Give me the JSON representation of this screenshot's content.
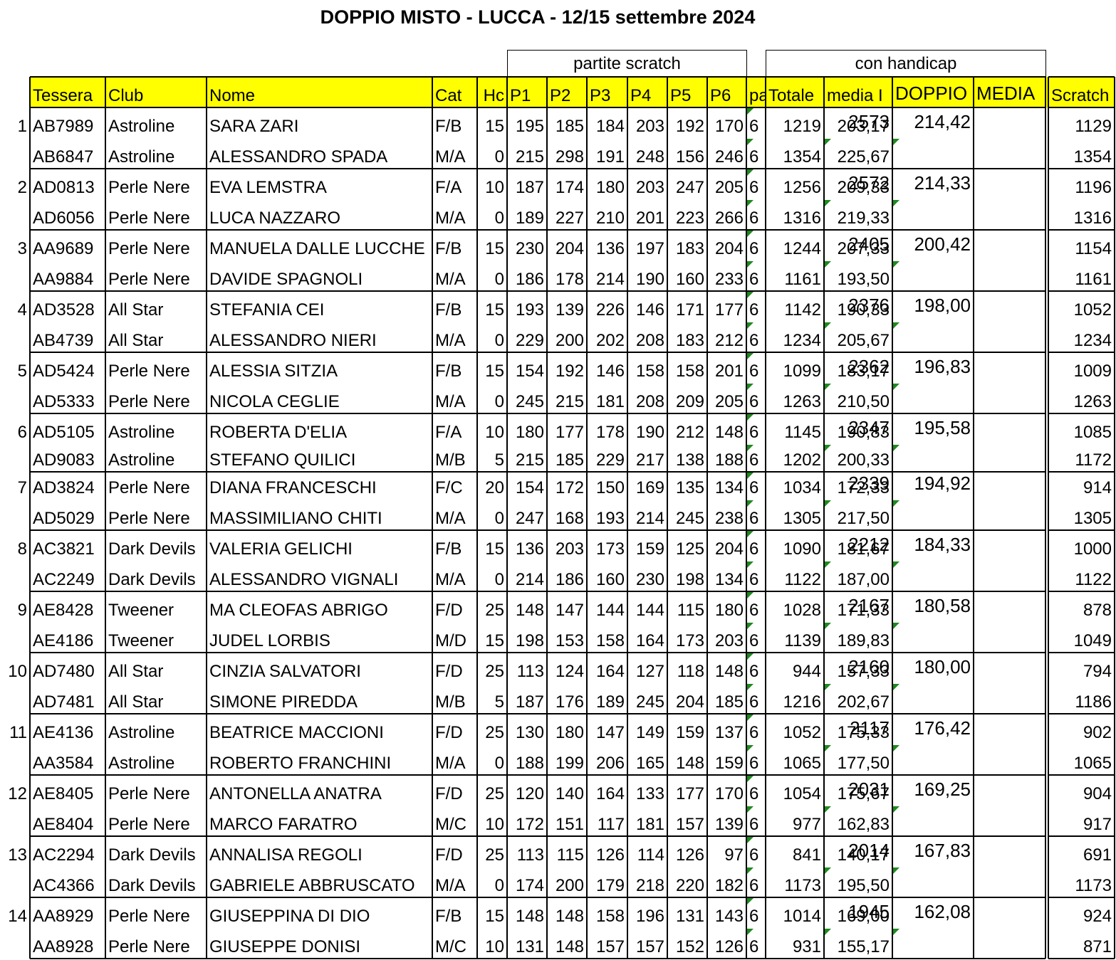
{
  "title": "DOPPIO MISTO - LUCCA - 12/15 settembre 2024",
  "groups": {
    "scratch": "partite scratch",
    "handicap": "con handicap"
  },
  "headers": [
    "Tessera",
    "Club",
    "Nome",
    "Cat",
    "Hc",
    "P1",
    "P2",
    "P3",
    "P4",
    "P5",
    "P6",
    "pa",
    "Totale",
    "media I",
    "DOPPIO",
    "MEDIA",
    "Scratch"
  ],
  "colors": {
    "header_fill": "#ffff00",
    "grid": "#000000",
    "flag": "#1e8a1e"
  },
  "teams": [
    {
      "pos": "1",
      "doppio": "2573",
      "media": "214,42",
      "players": [
        {
          "tessera": "AB7989",
          "club": "Astroline",
          "nome": "SARA ZARI",
          "cat": "F/B",
          "hc": "15",
          "p": [
            "195",
            "185",
            "184",
            "203",
            "192",
            "170"
          ],
          "pa": "6",
          "totale": "1219",
          "media_i": "203,17",
          "scratch": "1129"
        },
        {
          "tessera": "AB6847",
          "club": "Astroline",
          "nome": "ALESSANDRO SPADA",
          "cat": "M/A",
          "hc": "0",
          "p": [
            "215",
            "298",
            "191",
            "248",
            "156",
            "246"
          ],
          "pa": "6",
          "totale": "1354",
          "media_i": "225,67",
          "scratch": "1354"
        }
      ]
    },
    {
      "pos": "2",
      "doppio": "2572",
      "media": "214,33",
      "players": [
        {
          "tessera": "AD0813",
          "club": "Perle Nere",
          "nome": "EVA LEMSTRA",
          "cat": "F/A",
          "hc": "10",
          "p": [
            "187",
            "174",
            "180",
            "203",
            "247",
            "205"
          ],
          "pa": "6",
          "totale": "1256",
          "media_i": "209,33",
          "scratch": "1196"
        },
        {
          "tessera": "AD6056",
          "club": "Perle Nere",
          "nome": "LUCA NAZZARO",
          "cat": "M/A",
          "hc": "0",
          "p": [
            "189",
            "227",
            "210",
            "201",
            "223",
            "266"
          ],
          "pa": "6",
          "totale": "1316",
          "media_i": "219,33",
          "scratch": "1316"
        }
      ]
    },
    {
      "pos": "3",
      "doppio": "2405",
      "media": "200,42",
      "players": [
        {
          "tessera": "AA9689",
          "club": "Perle Nere",
          "nome": "MANUELA DALLE LUCCHE",
          "cat": "F/B",
          "hc": "15",
          "p": [
            "230",
            "204",
            "136",
            "197",
            "183",
            "204"
          ],
          "pa": "6",
          "totale": "1244",
          "media_i": "207,33",
          "scratch": "1154"
        },
        {
          "tessera": "AA9884",
          "club": "Perle Nere",
          "nome": "DAVIDE SPAGNOLI",
          "cat": "M/A",
          "hc": "0",
          "p": [
            "186",
            "178",
            "214",
            "190",
            "160",
            "233"
          ],
          "pa": "6",
          "totale": "1161",
          "media_i": "193,50",
          "scratch": "1161"
        }
      ]
    },
    {
      "pos": "4",
      "doppio": "2376",
      "media": "198,00",
      "players": [
        {
          "tessera": "AD3528",
          "club": "All Star",
          "nome": "STEFANIA CEI",
          "cat": "F/B",
          "hc": "15",
          "p": [
            "193",
            "139",
            "226",
            "146",
            "171",
            "177"
          ],
          "pa": "6",
          "totale": "1142",
          "media_i": "190,33",
          "scratch": "1052"
        },
        {
          "tessera": "AB4739",
          "club": "All Star",
          "nome": "ALESSANDRO NIERI",
          "cat": "M/A",
          "hc": "0",
          "p": [
            "229",
            "200",
            "202",
            "208",
            "183",
            "212"
          ],
          "pa": "6",
          "totale": "1234",
          "media_i": "205,67",
          "scratch": "1234"
        }
      ]
    },
    {
      "pos": "5",
      "doppio": "2362",
      "media": "196,83",
      "players": [
        {
          "tessera": "AD5424",
          "club": "Perle Nere",
          "nome": "ALESSIA SITZIA",
          "cat": "F/B",
          "hc": "15",
          "p": [
            "154",
            "192",
            "146",
            "158",
            "158",
            "201"
          ],
          "pa": "6",
          "totale": "1099",
          "media_i": "183,17",
          "scratch": "1009"
        },
        {
          "tessera": "AD5333",
          "club": "Perle Nere",
          "nome": "NICOLA CEGLIE",
          "cat": "M/A",
          "hc": "0",
          "p": [
            "245",
            "215",
            "181",
            "208",
            "209",
            "205"
          ],
          "pa": "6",
          "totale": "1263",
          "media_i": "210,50",
          "scratch": "1263"
        }
      ]
    },
    {
      "pos": "6",
      "doppio": "2347",
      "media": "195,58",
      "players": [
        {
          "tessera": "AD5105",
          "club": "Astroline",
          "nome": "ROBERTA D'ELIA",
          "cat": "F/A",
          "hc": "10",
          "p": [
            "180",
            "177",
            "178",
            "190",
            "212",
            "148"
          ],
          "pa": "6",
          "totale": "1145",
          "media_i": "190,83",
          "scratch": "1085"
        },
        {
          "tessera": "AD9083",
          "club": "Astroline",
          "nome": "STEFANO QUILICI",
          "cat": "M/B",
          "hc": "5",
          "p": [
            "215",
            "185",
            "229",
            "217",
            "138",
            "188"
          ],
          "pa": "6",
          "totale": "1202",
          "media_i": "200,33",
          "scratch": "1172"
        }
      ]
    },
    {
      "pos": "7",
      "doppio": "2339",
      "media": "194,92",
      "players": [
        {
          "tessera": "AD3824",
          "club": "Perle Nere",
          "nome": "DIANA FRANCESCHI",
          "cat": "F/C",
          "hc": "20",
          "p": [
            "154",
            "172",
            "150",
            "169",
            "135",
            "134"
          ],
          "pa": "6",
          "totale": "1034",
          "media_i": "172,33",
          "scratch": "914"
        },
        {
          "tessera": "AD5029",
          "club": "Perle Nere",
          "nome": "MASSIMILIANO CHITI",
          "cat": "M/A",
          "hc": "0",
          "p": [
            "247",
            "168",
            "193",
            "214",
            "245",
            "238"
          ],
          "pa": "6",
          "totale": "1305",
          "media_i": "217,50",
          "scratch": "1305"
        }
      ]
    },
    {
      "pos": "8",
      "doppio": "2212",
      "media": "184,33",
      "players": [
        {
          "tessera": "AC3821",
          "club": "Dark Devils",
          "nome": "VALERIA GELICHI",
          "cat": "F/B",
          "hc": "15",
          "p": [
            "136",
            "203",
            "173",
            "159",
            "125",
            "204"
          ],
          "pa": "6",
          "totale": "1090",
          "media_i": "181,67",
          "scratch": "1000"
        },
        {
          "tessera": "AC2249",
          "club": "Dark Devils",
          "nome": "ALESSANDRO VIGNALI",
          "cat": "M/A",
          "hc": "0",
          "p": [
            "214",
            "186",
            "160",
            "230",
            "198",
            "134"
          ],
          "pa": "6",
          "totale": "1122",
          "media_i": "187,00",
          "scratch": "1122"
        }
      ]
    },
    {
      "pos": "9",
      "doppio": "2167",
      "media": "180,58",
      "players": [
        {
          "tessera": "AE8428",
          "club": "Tweener",
          "nome": "MA CLEOFAS ABRIGO",
          "cat": "F/D",
          "hc": "25",
          "p": [
            "148",
            "147",
            "144",
            "144",
            "115",
            "180"
          ],
          "pa": "6",
          "totale": "1028",
          "media_i": "171,33",
          "scratch": "878"
        },
        {
          "tessera": "AE4186",
          "club": "Tweener",
          "nome": "JUDEL LORBIS",
          "cat": "M/D",
          "hc": "15",
          "p": [
            "198",
            "153",
            "158",
            "164",
            "173",
            "203"
          ],
          "pa": "6",
          "totale": "1139",
          "media_i": "189,83",
          "scratch": "1049"
        }
      ]
    },
    {
      "pos": "10",
      "doppio": "2160",
      "media": "180,00",
      "players": [
        {
          "tessera": "AD7480",
          "club": "All Star",
          "nome": "CINZIA SALVATORI",
          "cat": "F/D",
          "hc": "25",
          "p": [
            "113",
            "124",
            "164",
            "127",
            "118",
            "148"
          ],
          "pa": "6",
          "totale": "944",
          "media_i": "157,33",
          "scratch": "794"
        },
        {
          "tessera": "AD7481",
          "club": "All Star",
          "nome": "SIMONE PIREDDA",
          "cat": "M/B",
          "hc": "5",
          "p": [
            "187",
            "176",
            "189",
            "245",
            "204",
            "185"
          ],
          "pa": "6",
          "totale": "1216",
          "media_i": "202,67",
          "scratch": "1186"
        }
      ]
    },
    {
      "pos": "11",
      "doppio": "2117",
      "media": "176,42",
      "players": [
        {
          "tessera": "AE4136",
          "club": "Astroline",
          "nome": "BEATRICE MACCIONI",
          "cat": "F/D",
          "hc": "25",
          "p": [
            "130",
            "180",
            "147",
            "149",
            "159",
            "137"
          ],
          "pa": "6",
          "totale": "1052",
          "media_i": "175,33",
          "scratch": "902"
        },
        {
          "tessera": "AA3584",
          "club": "Astroline",
          "nome": "ROBERTO FRANCHINI",
          "cat": "M/A",
          "hc": "0",
          "p": [
            "188",
            "199",
            "206",
            "165",
            "148",
            "159"
          ],
          "pa": "6",
          "totale": "1065",
          "media_i": "177,50",
          "scratch": "1065"
        }
      ]
    },
    {
      "pos": "12",
      "doppio": "2031",
      "media": "169,25",
      "players": [
        {
          "tessera": "AE8405",
          "club": "Perle Nere",
          "nome": "ANTONELLA ANATRA",
          "cat": "F/D",
          "hc": "25",
          "p": [
            "120",
            "140",
            "164",
            "133",
            "177",
            "170"
          ],
          "pa": "6",
          "totale": "1054",
          "media_i": "175,67",
          "scratch": "904"
        },
        {
          "tessera": "AE8404",
          "club": "Perle Nere",
          "nome": "MARCO FARATRO",
          "cat": "M/C",
          "hc": "10",
          "p": [
            "172",
            "151",
            "117",
            "181",
            "157",
            "139"
          ],
          "pa": "6",
          "totale": "977",
          "media_i": "162,83",
          "scratch": "917"
        }
      ]
    },
    {
      "pos": "13",
      "doppio": "2014",
      "media": "167,83",
      "players": [
        {
          "tessera": "AC2294",
          "club": "Dark Devils",
          "nome": "ANNALISA REGOLI",
          "cat": "F/D",
          "hc": "25",
          "p": [
            "113",
            "115",
            "126",
            "114",
            "126",
            "97"
          ],
          "pa": "6",
          "totale": "841",
          "media_i": "140,17",
          "scratch": "691"
        },
        {
          "tessera": "AC4366",
          "club": "Dark Devils",
          "nome": "GABRIELE ABBRUSCATO",
          "cat": "M/A",
          "hc": "0",
          "p": [
            "174",
            "200",
            "179",
            "218",
            "220",
            "182"
          ],
          "pa": "6",
          "totale": "1173",
          "media_i": "195,50",
          "scratch": "1173"
        }
      ]
    },
    {
      "pos": "14",
      "doppio": "1945",
      "media": "162,08",
      "players": [
        {
          "tessera": "AA8929",
          "club": "Perle Nere",
          "nome": "GIUSEPPINA DI DIO",
          "cat": "F/B",
          "hc": "15",
          "p": [
            "148",
            "148",
            "158",
            "196",
            "131",
            "143"
          ],
          "pa": "6",
          "totale": "1014",
          "media_i": "169,00",
          "scratch": "924"
        },
        {
          "tessera": "AA8928",
          "club": "Perle Nere",
          "nome": "GIUSEPPE DONISI",
          "cat": "M/C",
          "hc": "10",
          "p": [
            "131",
            "148",
            "157",
            "157",
            "152",
            "126"
          ],
          "pa": "6",
          "totale": "931",
          "media_i": "155,17",
          "scratch": "871"
        }
      ]
    }
  ]
}
